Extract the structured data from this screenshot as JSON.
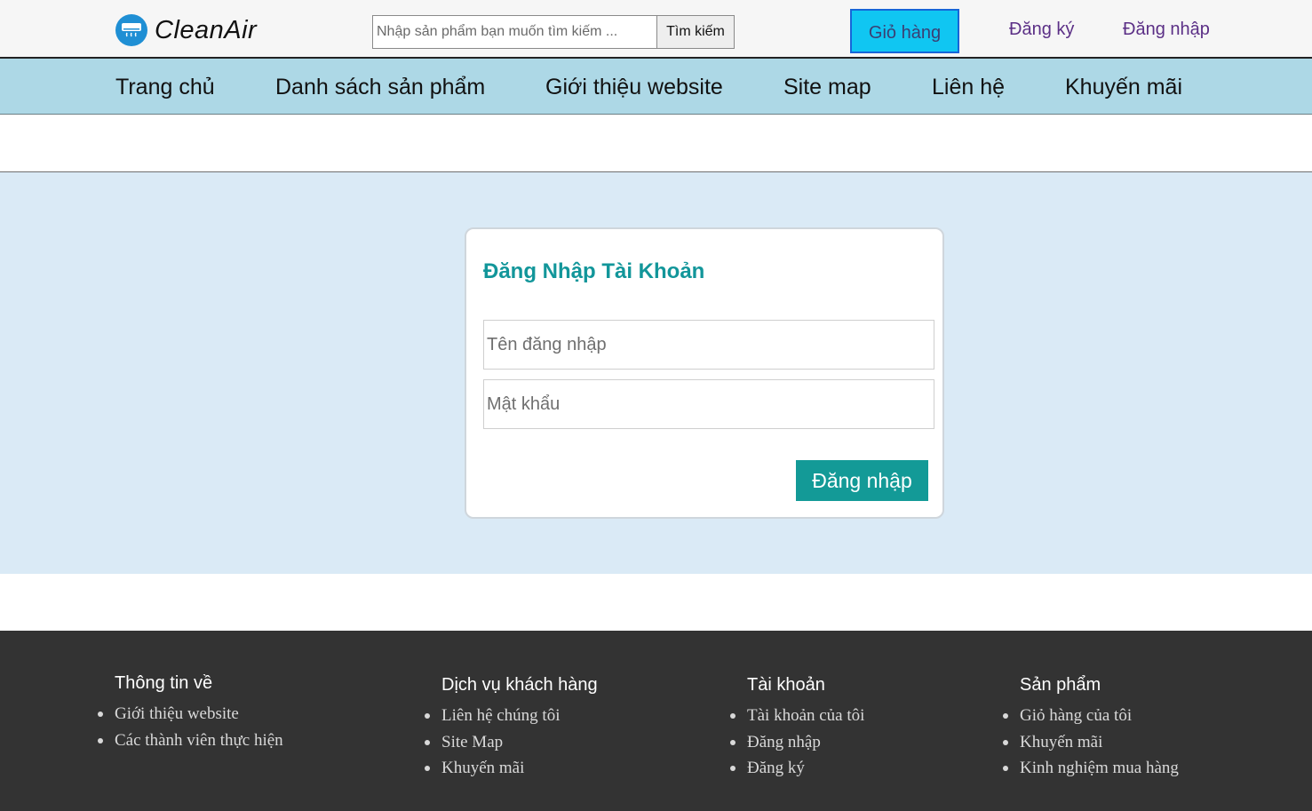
{
  "header": {
    "logo_text": "CleanAir",
    "search_placeholder": "Nhập sản phẩm bạn muốn tìm kiếm ...",
    "search_button": "Tìm kiếm",
    "cart_button": "Giỏ hàng",
    "register_link": "Đăng ký",
    "login_link": "Đăng nhập"
  },
  "nav": {
    "items": [
      "Trang chủ",
      "Danh sách sản phẩm",
      "Giới thiệu website",
      "Site map",
      "Liên hệ",
      "Khuyến mãi"
    ]
  },
  "login": {
    "title": "Đăng Nhập Tài Khoản",
    "username_placeholder": "Tên đăng nhập",
    "password_placeholder": "Mật khẩu",
    "submit_label": "Đăng nhập"
  },
  "footer": {
    "columns": [
      {
        "title": "Thông tin về",
        "items": [
          "Giới thiệu website",
          "Các thành viên thực hiện"
        ]
      },
      {
        "title": "Dịch vụ khách hàng",
        "items": [
          "Liên hệ chúng tôi",
          "Site Map",
          "Khuyến mãi"
        ]
      },
      {
        "title": "Tài khoản",
        "items": [
          "Tài khoản của tôi",
          "Đăng nhập",
          "Đăng ký"
        ]
      },
      {
        "title": "Sản phẩm",
        "items": [
          "Giỏ hàng của tôi",
          "Khuyến mãi",
          "Kinh nghiệm mua hàng"
        ]
      }
    ]
  },
  "colors": {
    "nav_bg": "#add8e6",
    "cart_bg": "#10c6f2",
    "accent_teal": "#139a97",
    "main_bg": "#daeaf6",
    "footer_bg": "#333333",
    "link_purple": "#5b2f86"
  },
  "icons": {
    "logo": "air-conditioner-icon"
  }
}
